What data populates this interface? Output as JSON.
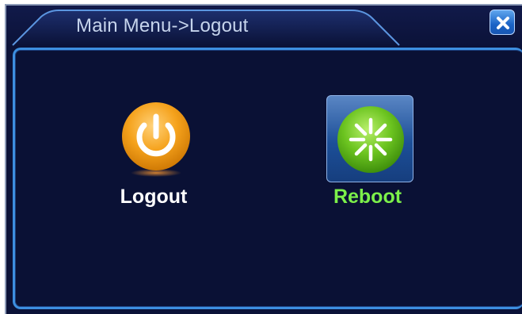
{
  "window": {
    "title": "Main Menu->Logout"
  },
  "options": [
    {
      "label": "Logout",
      "icon": "power-icon",
      "selected": false,
      "color": "#ffffff"
    },
    {
      "label": "Reboot",
      "icon": "reboot-icon",
      "selected": true,
      "color": "#7cf04a"
    }
  ],
  "colors": {
    "background": "#0b1238",
    "panel_border": "#3d8fe0",
    "title_text": "#c6d4ec",
    "selected_label": "#7cf04a",
    "normal_label": "#ffffff"
  }
}
